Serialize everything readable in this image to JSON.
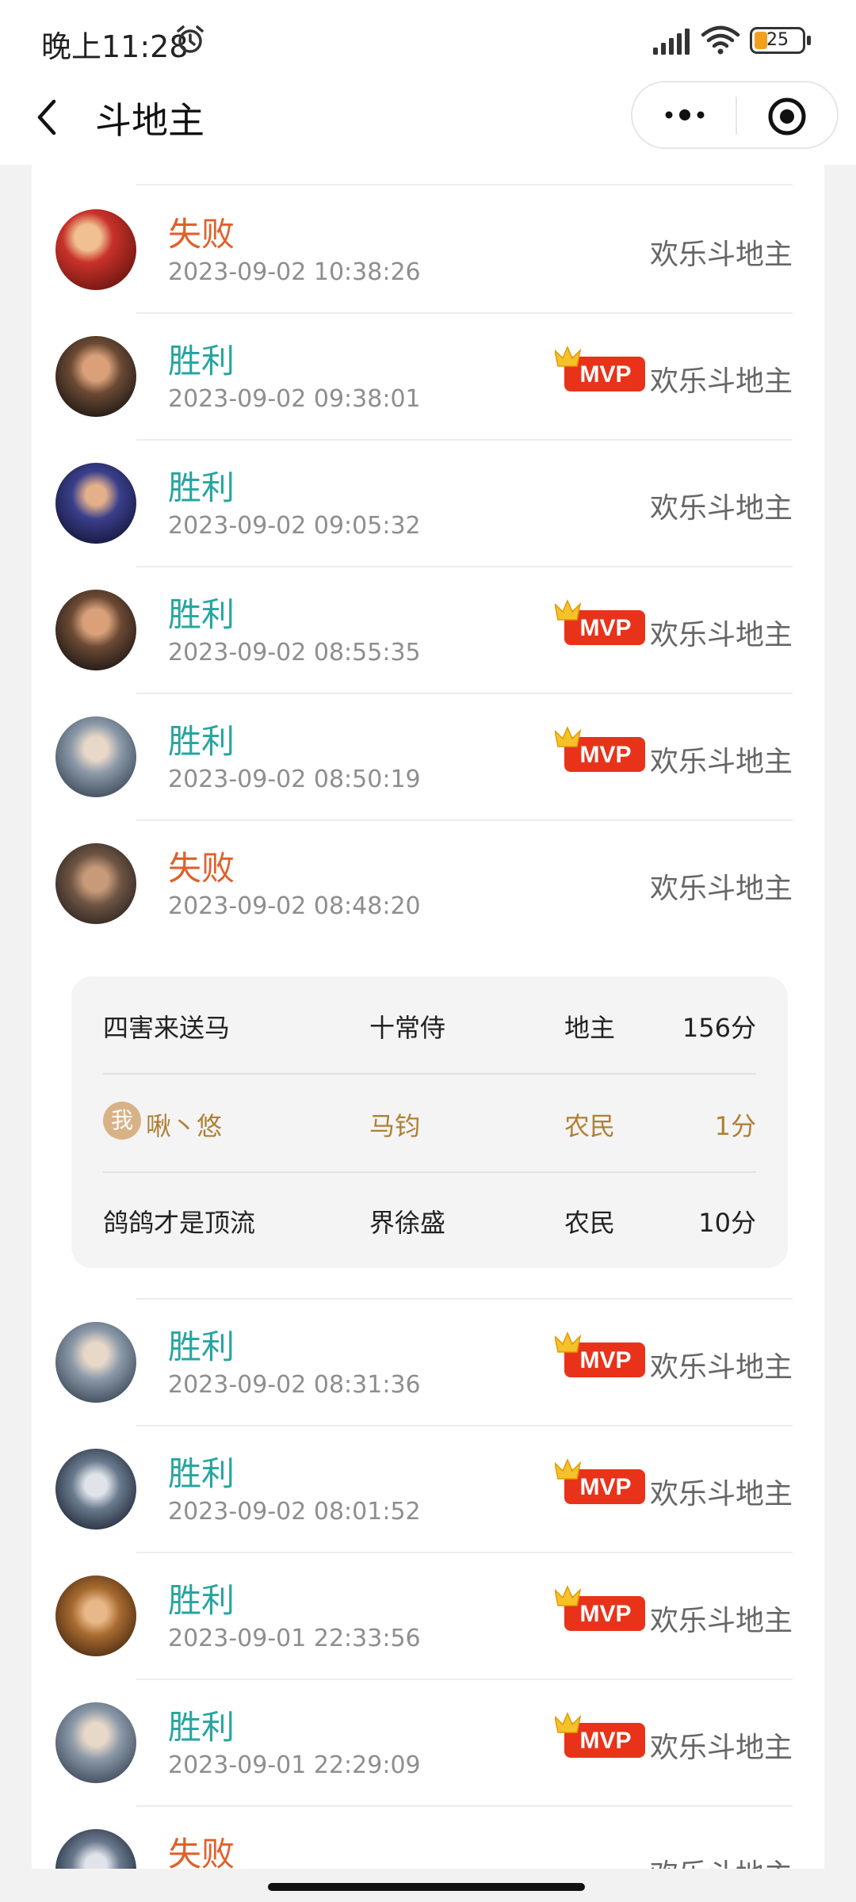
{
  "status_bar": {
    "time": "晚上11:28",
    "battery": "25"
  },
  "header": {
    "title": "斗地主"
  },
  "colors": {
    "win": "#27a5a0",
    "lose": "#e0602c",
    "self_highlight": "#b08035",
    "mvp_badge": "#e8331a"
  },
  "games_top": [
    {
      "result": "失败",
      "outcome": "lose",
      "time": "2023-09-02 10:38:26",
      "mvp": false,
      "mode": "欢乐斗地主",
      "avatar_icon": "avatar-red-hero-icon"
    },
    {
      "result": "胜利",
      "outcome": "win",
      "time": "2023-09-02 09:38:01",
      "mvp": true,
      "mode": "欢乐斗地主",
      "avatar_icon": "avatar-bearded-hero-icon"
    },
    {
      "result": "胜利",
      "outcome": "win",
      "time": "2023-09-02 09:05:32",
      "mvp": false,
      "mode": "欢乐斗地主",
      "avatar_icon": "avatar-blue-hero-icon"
    },
    {
      "result": "胜利",
      "outcome": "win",
      "time": "2023-09-02 08:55:35",
      "mvp": true,
      "mode": "欢乐斗地主",
      "avatar_icon": "avatar-bearded-hero-icon"
    },
    {
      "result": "胜利",
      "outcome": "win",
      "time": "2023-09-02 08:50:19",
      "mvp": true,
      "mode": "欢乐斗地主",
      "avatar_icon": "avatar-silver-hero-icon"
    },
    {
      "result": "失败",
      "outcome": "lose",
      "time": "2023-09-02 08:48:20",
      "mvp": false,
      "mode": "欢乐斗地主",
      "avatar_icon": "avatar-brown-hero-icon"
    }
  ],
  "detail": {
    "players": [
      {
        "name": "四害来送马",
        "hero": "十常侍",
        "role": "地主",
        "score": "156分",
        "is_me": false
      },
      {
        "me_label": "我",
        "name": "啾丶悠",
        "hero": "马钧",
        "role": "农民",
        "score": "1分",
        "is_me": true
      },
      {
        "name": "鸽鸽才是顶流",
        "hero": "界徐盛",
        "role": "农民",
        "score": "10分",
        "is_me": false
      }
    ]
  },
  "games_bottom": [
    {
      "result": "胜利",
      "outcome": "win",
      "time": "2023-09-02 08:31:36",
      "mvp": true,
      "mode": "欢乐斗地主",
      "avatar_icon": "avatar-silver-hero-icon"
    },
    {
      "result": "胜利",
      "outcome": "win",
      "time": "2023-09-02 08:01:52",
      "mvp": true,
      "mode": "欢乐斗地主",
      "avatar_icon": "avatar-masked-hero-icon"
    },
    {
      "result": "胜利",
      "outcome": "win",
      "time": "2023-09-01 22:33:56",
      "mvp": true,
      "mode": "欢乐斗地主",
      "avatar_icon": "avatar-golden-hero-icon"
    },
    {
      "result": "胜利",
      "outcome": "win",
      "time": "2023-09-01 22:29:09",
      "mvp": true,
      "mode": "欢乐斗地主",
      "avatar_icon": "avatar-silver-hero-icon"
    },
    {
      "result": "失败",
      "outcome": "lose",
      "time": "",
      "mvp": false,
      "mode": "欢乐斗地主",
      "avatar_icon": "avatar-masked-hero-icon"
    }
  ],
  "mvp_label": "MVP"
}
